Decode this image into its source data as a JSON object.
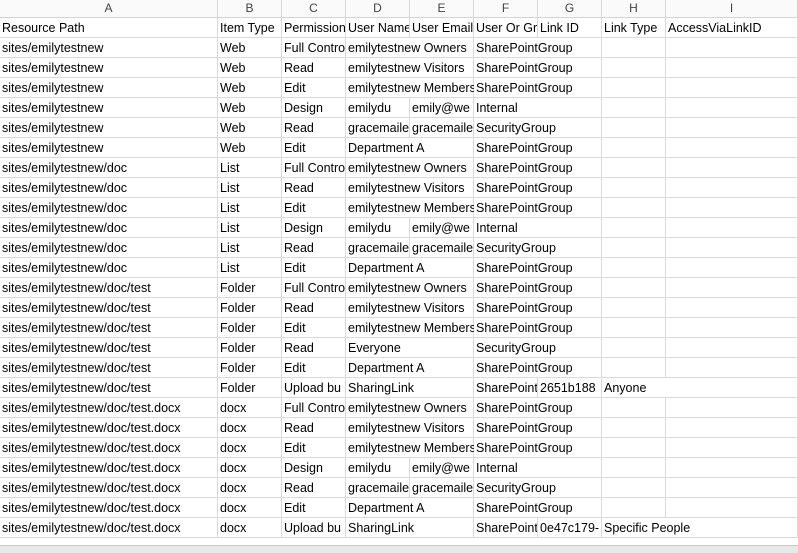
{
  "columns": [
    "A",
    "B",
    "C",
    "D",
    "E",
    "F",
    "G",
    "H",
    "I"
  ],
  "header": [
    "Resource Path",
    "Item Type",
    "Permission",
    "User Name",
    "User Email",
    "User Or Gr",
    "Link ID",
    "Link Type",
    "AccessViaLinkID"
  ],
  "rows": [
    [
      "sites/emilytestnew",
      "Web",
      "Full Control",
      "emilytestnew Owners",
      "",
      "SharePointGroup",
      "",
      "",
      ""
    ],
    [
      "sites/emilytestnew",
      "Web",
      "Read",
      "emilytestnew Visitors",
      "",
      "SharePointGroup",
      "",
      "",
      ""
    ],
    [
      "sites/emilytestnew",
      "Web",
      "Edit",
      "emilytestnew Members",
      "",
      "SharePointGroup",
      "",
      "",
      ""
    ],
    [
      "sites/emilytestnew",
      "Web",
      "Design",
      "emilydu",
      "emily@we",
      "Internal",
      "",
      "",
      ""
    ],
    [
      "sites/emilytestnew",
      "Web",
      "Read",
      "gracemaile",
      "gracemaile",
      "SecurityGroup",
      "",
      "",
      ""
    ],
    [
      "sites/emilytestnew",
      "Web",
      "Edit",
      "Department A",
      "",
      "SharePointGroup",
      "",
      "",
      ""
    ],
    [
      "sites/emilytestnew/doc",
      "List",
      "Full Control",
      "emilytestnew Owners",
      "",
      "SharePointGroup",
      "",
      "",
      ""
    ],
    [
      "sites/emilytestnew/doc",
      "List",
      "Read",
      "emilytestnew Visitors",
      "",
      "SharePointGroup",
      "",
      "",
      ""
    ],
    [
      "sites/emilytestnew/doc",
      "List",
      "Edit",
      "emilytestnew Members",
      "",
      "SharePointGroup",
      "",
      "",
      ""
    ],
    [
      "sites/emilytestnew/doc",
      "List",
      "Design",
      "emilydu",
      "emily@we",
      "Internal",
      "",
      "",
      ""
    ],
    [
      "sites/emilytestnew/doc",
      "List",
      "Read",
      "gracemaile",
      "gracemaile",
      "SecurityGroup",
      "",
      "",
      ""
    ],
    [
      "sites/emilytestnew/doc",
      "List",
      "Edit",
      "Department A",
      "",
      "SharePointGroup",
      "",
      "",
      ""
    ],
    [
      "sites/emilytestnew/doc/test",
      "Folder",
      "Full Control",
      "emilytestnew Owners",
      "",
      "SharePointGroup",
      "",
      "",
      ""
    ],
    [
      "sites/emilytestnew/doc/test",
      "Folder",
      "Read",
      "emilytestnew Visitors",
      "",
      "SharePointGroup",
      "",
      "",
      ""
    ],
    [
      "sites/emilytestnew/doc/test",
      "Folder",
      "Edit",
      "emilytestnew Members",
      "",
      "SharePointGroup",
      "",
      "",
      ""
    ],
    [
      "sites/emilytestnew/doc/test",
      "Folder",
      "Read",
      "Everyone",
      "",
      "SecurityGroup",
      "",
      "",
      ""
    ],
    [
      "sites/emilytestnew/doc/test",
      "Folder",
      "Edit",
      "Department A",
      "",
      "SharePointGroup",
      "",
      "",
      ""
    ],
    [
      "sites/emilytestnew/doc/test",
      "Folder",
      "Upload bu",
      "SharingLink",
      "",
      "SharePoint",
      "2651b188",
      "Anyone",
      ""
    ],
    [
      "sites/emilytestnew/doc/test.docx",
      "docx",
      "Full Control",
      "emilytestnew Owners",
      "",
      "SharePointGroup",
      "",
      "",
      ""
    ],
    [
      "sites/emilytestnew/doc/test.docx",
      "docx",
      "Read",
      "emilytestnew Visitors",
      "",
      "SharePointGroup",
      "",
      "",
      ""
    ],
    [
      "sites/emilytestnew/doc/test.docx",
      "docx",
      "Edit",
      "emilytestnew Members",
      "",
      "SharePointGroup",
      "",
      "",
      ""
    ],
    [
      "sites/emilytestnew/doc/test.docx",
      "docx",
      "Design",
      "emilydu",
      "emily@we",
      "Internal",
      "",
      "",
      ""
    ],
    [
      "sites/emilytestnew/doc/test.docx",
      "docx",
      "Read",
      "gracemaile",
      "gracemaile",
      "SecurityGroup",
      "",
      "",
      ""
    ],
    [
      "sites/emilytestnew/doc/test.docx",
      "docx",
      "Edit",
      "Department A",
      "",
      "SharePointGroup",
      "",
      "",
      ""
    ],
    [
      "sites/emilytestnew/doc/test.docx",
      "docx",
      "Upload bu",
      "SharingLink",
      "",
      "SharePoint",
      "0e47c179-",
      "Specific People",
      ""
    ]
  ]
}
